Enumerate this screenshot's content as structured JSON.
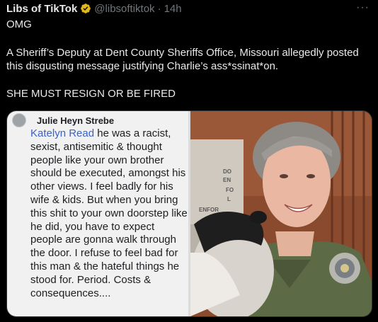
{
  "tweet": {
    "author_name": "Libs of TikTok",
    "handle": "@libsoftiktok",
    "separator": "·",
    "time": "14h",
    "more_label": "···",
    "line1": "OMG",
    "line2": "A Sheriff’s Deputy at Dent County Sheriffs Office, Missouri allegedly posted this disgusting message justifying Charlie’s ass*ssinat*on.",
    "line3": "SHE MUST RESIGN OR BE FIRED",
    "verified_icon": "verified-badge-gold"
  },
  "media": {
    "fb_post": {
      "author": "Julie Heyn Strebe",
      "mention": "Katelyn Read",
      "text": " he was a racist, sexist, antisemitic & thought people like your own brother should be executed, amongst his other views. I feel badly for his wife & kids. But when you bring this shit to your own doorstep like he did, you have to expect people are gonna walk through the door. I refuse to feel bad for this man & the hateful things he stood for. Period. Costs & consequences...."
    },
    "sign_lines": [
      "DO",
      "EN",
      "FO",
      "L",
      "ENFOR"
    ]
  },
  "colors": {
    "background": "#000000",
    "text": "#e7e9ea",
    "muted": "#71767b",
    "verified": "#e2b719",
    "fb_link": "#3a62c9"
  }
}
